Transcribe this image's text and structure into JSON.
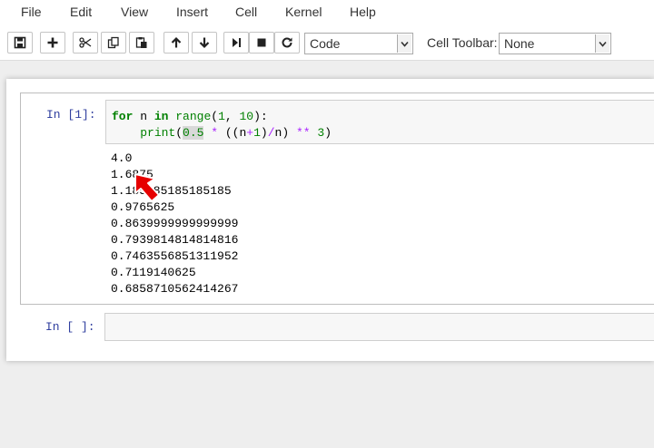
{
  "menu": [
    "File",
    "Edit",
    "View",
    "Insert",
    "Cell",
    "Kernel",
    "Help"
  ],
  "toolbar": {
    "buttons": [
      "save-icon",
      "add-cell-icon",
      "cut-icon",
      "copy-icon",
      "paste-icon",
      "move-up-icon",
      "move-down-icon",
      "run-icon",
      "stop-icon",
      "restart-icon"
    ],
    "cell_type": "Code",
    "cell_toolbar_label": "Cell Toolbar:",
    "cell_toolbar_value": "None"
  },
  "cells": [
    {
      "prompt": "In [1]:",
      "code": {
        "line1": {
          "kw": "for",
          "sp1": " n ",
          "in": "in",
          "sp2": " ",
          "range": "range",
          "open": "(",
          "a": "1",
          "comma": ", ",
          "b": "10",
          "close": "):"
        },
        "line2": {
          "indent": "    ",
          "print": "print",
          "open": "(",
          "half": "0.5",
          "sp1": " ",
          "mul": "*",
          "sp2": " ((n",
          "plus": "+",
          "one": "1",
          "div_open": ")",
          "div": "/",
          "n": "n)",
          "sp3": " ",
          "pow": "**",
          "sp4": " ",
          "three": "3",
          "close": ")"
        }
      },
      "output": [
        "4.0",
        "1.6875",
        "1.185185185185185",
        "0.9765625",
        "0.8639999999999999",
        "0.7939814814814816",
        "0.7463556851311952",
        "0.7119140625",
        "0.6858710562414267"
      ]
    },
    {
      "prompt": "In [ ]:"
    }
  ],
  "colors": {
    "keyword": "#008000",
    "operator": "#aa22ff",
    "prompt": "#303f9f",
    "cursor": "#e60000"
  }
}
